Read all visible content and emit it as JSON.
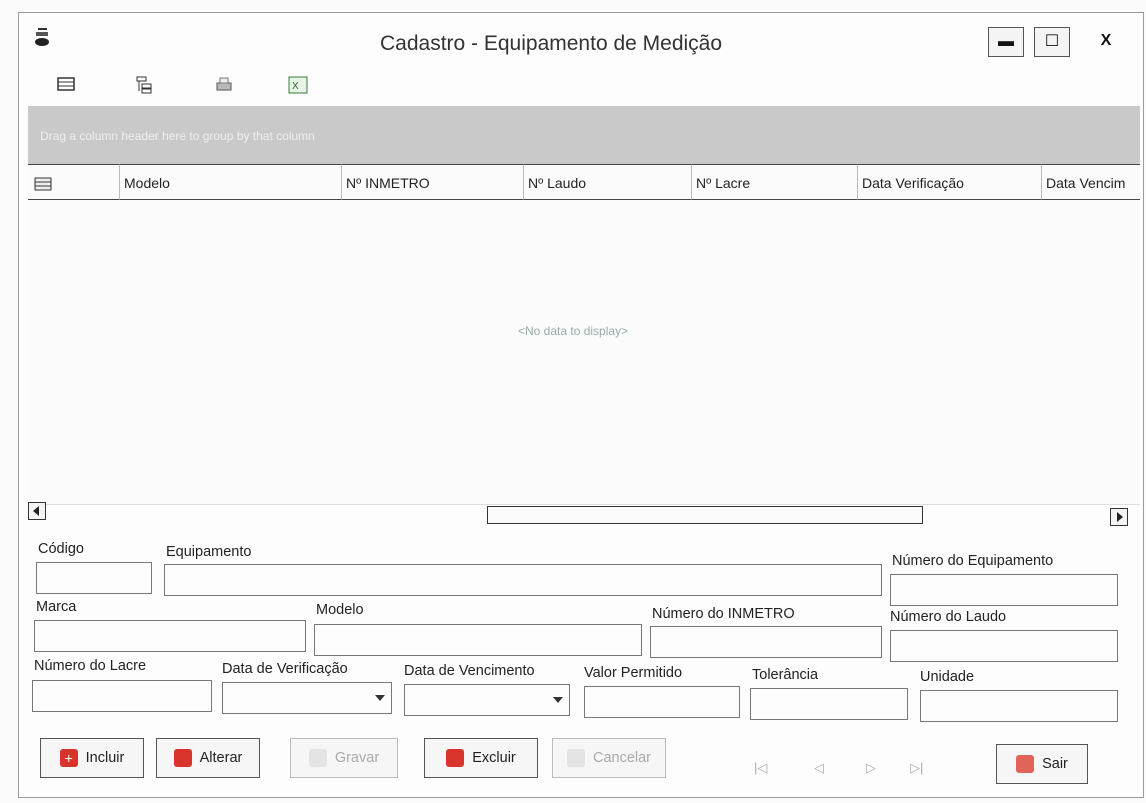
{
  "window": {
    "title": "Cadastro - Equipamento de Medição",
    "min_glyph": "▬",
    "max_glyph": "☐",
    "close_glyph": "X"
  },
  "toolbar": {
    "icons": [
      "layout-icon",
      "tree-icon",
      "print-icon",
      "excel-icon"
    ]
  },
  "grid": {
    "group_hint": "Drag a column header here to group by that column",
    "columns": [
      "Modelo",
      "Nº INMETRO",
      "Nº Laudo",
      "Nº Lacre",
      "Data Verificação",
      "Data Vencim"
    ],
    "empty_text": "<No data to display>"
  },
  "form": {
    "codigo": {
      "label": "Código",
      "value": ""
    },
    "equipamento": {
      "label": "Equipamento",
      "value": ""
    },
    "numero_equipamento": {
      "label": "Número do Equipamento",
      "value": ""
    },
    "marca": {
      "label": "Marca",
      "value": ""
    },
    "modelo": {
      "label": "Modelo",
      "value": ""
    },
    "numero_inmetro": {
      "label": "Número do INMETRO",
      "value": ""
    },
    "numero_laudo": {
      "label": "Número do Laudo",
      "value": ""
    },
    "numero_lacre": {
      "label": "Número do Lacre",
      "value": ""
    },
    "data_verificacao": {
      "label": "Data de Verificação",
      "value": ""
    },
    "data_vencimento": {
      "label": "Data de Vencimento",
      "value": ""
    },
    "valor_permitido": {
      "label": "Valor Permitido",
      "value": ""
    },
    "tolerancia": {
      "label": "Tolerância",
      "value": ""
    },
    "unidade": {
      "label": "Unidade",
      "value": ""
    }
  },
  "buttons": {
    "incluir": "Incluir",
    "alterar": "Alterar",
    "gravar": "Gravar",
    "excluir": "Excluir",
    "cancelar": "Cancelar",
    "sair": "Sair"
  },
  "navigator": {
    "first": "|◁",
    "prev": "◁",
    "next": "▷",
    "last": "▷|"
  },
  "colors": {
    "accent_red": "#d9342b",
    "groupbar": "#c9c9c9"
  }
}
